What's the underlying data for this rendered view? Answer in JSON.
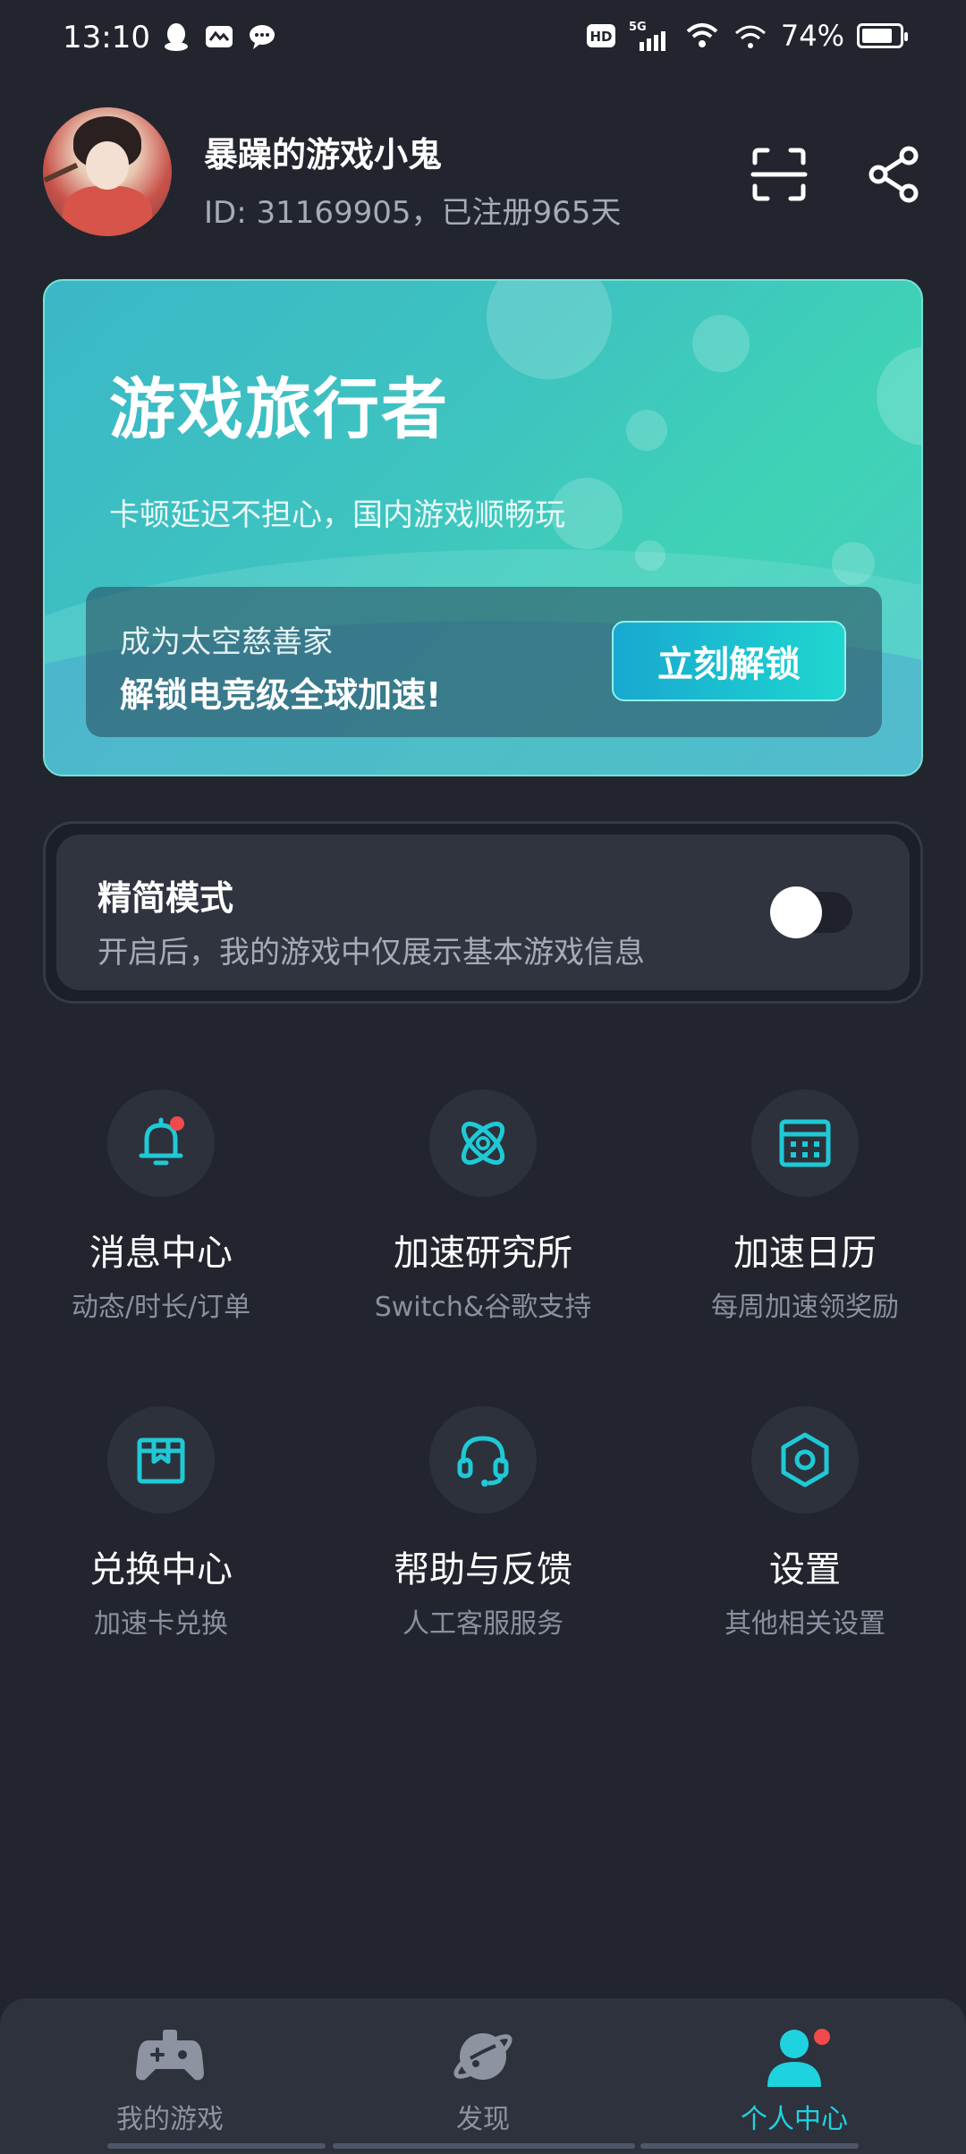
{
  "status_bar": {
    "time": "13:10",
    "left_icons": [
      "qq-penguin-icon",
      "mail-icon",
      "chat-bubble-icon"
    ],
    "right_icons": [
      "hd-icon",
      "5g-signal-icon",
      "wifi-icon",
      "wifi-icon-2"
    ],
    "battery_percent": "74%"
  },
  "profile": {
    "name": "暴躁的游戏小鬼",
    "id_line": "ID: 31169905，已注册965天",
    "actions": [
      "scan-icon",
      "share-icon"
    ]
  },
  "promo": {
    "title": "游戏旅行者",
    "subtitle": "卡顿延迟不担心，国内游戏顺畅玩",
    "box_line1": "成为太空慈善家",
    "box_line2": "解锁电竞级全球加速!",
    "button": "立刻解锁"
  },
  "simple_mode": {
    "title": "精简模式",
    "description": "开启后，我的游戏中仅展示基本游戏信息",
    "enabled": false
  },
  "menu": [
    {
      "title": "消息中心",
      "subtitle": "动态/时长/订单",
      "icon": "bell-icon",
      "badge": true
    },
    {
      "title": "加速研究所",
      "subtitle": "Switch&谷歌支持",
      "icon": "atom-icon",
      "badge": false
    },
    {
      "title": "加速日历",
      "subtitle": "每周加速领奖励",
      "icon": "calendar-icon",
      "badge": false
    },
    {
      "title": "兑换中心",
      "subtitle": "加速卡兑换",
      "icon": "gift-box-icon",
      "badge": false
    },
    {
      "title": "帮助与反馈",
      "subtitle": "人工客服服务",
      "icon": "headset-icon",
      "badge": false
    },
    {
      "title": "设置",
      "subtitle": "其他相关设置",
      "icon": "settings-hexagon-icon",
      "badge": false
    }
  ],
  "bottom_nav": [
    {
      "label": "我的游戏",
      "icon": "gamepad-icon",
      "active": false
    },
    {
      "label": "发现",
      "icon": "planet-icon",
      "active": false
    },
    {
      "label": "个人中心",
      "icon": "user-icon",
      "active": true,
      "badge": true
    }
  ],
  "colors": {
    "background": "#22252e",
    "accent": "#1fd2e0",
    "badge": "#f04a4a"
  }
}
